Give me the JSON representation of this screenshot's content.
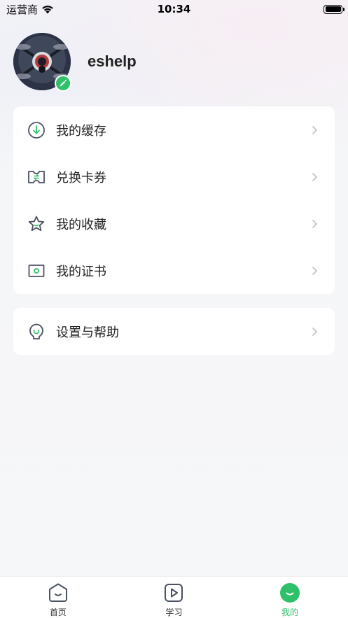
{
  "status_bar": {
    "carrier": "运营商",
    "time": "10:34"
  },
  "profile": {
    "username": "eshelp"
  },
  "menu": {
    "items": [
      {
        "label": "我的缓存",
        "icon": "download-icon"
      },
      {
        "label": "兑换卡券",
        "icon": "ticket-icon"
      },
      {
        "label": "我的收藏",
        "icon": "star-icon"
      },
      {
        "label": "我的证书",
        "icon": "certificate-icon"
      }
    ]
  },
  "settings": {
    "label": "设置与帮助",
    "icon": "lightbulb-icon"
  },
  "tabbar": {
    "tabs": [
      {
        "label": "首页",
        "icon": "home-icon",
        "active": false
      },
      {
        "label": "学习",
        "icon": "play-icon",
        "active": false
      },
      {
        "label": "我的",
        "icon": "smile-icon",
        "active": true
      }
    ]
  },
  "colors": {
    "accent": "#2fc06a",
    "icon_gray": "#4a5160",
    "chevron": "#c4c4c4"
  }
}
